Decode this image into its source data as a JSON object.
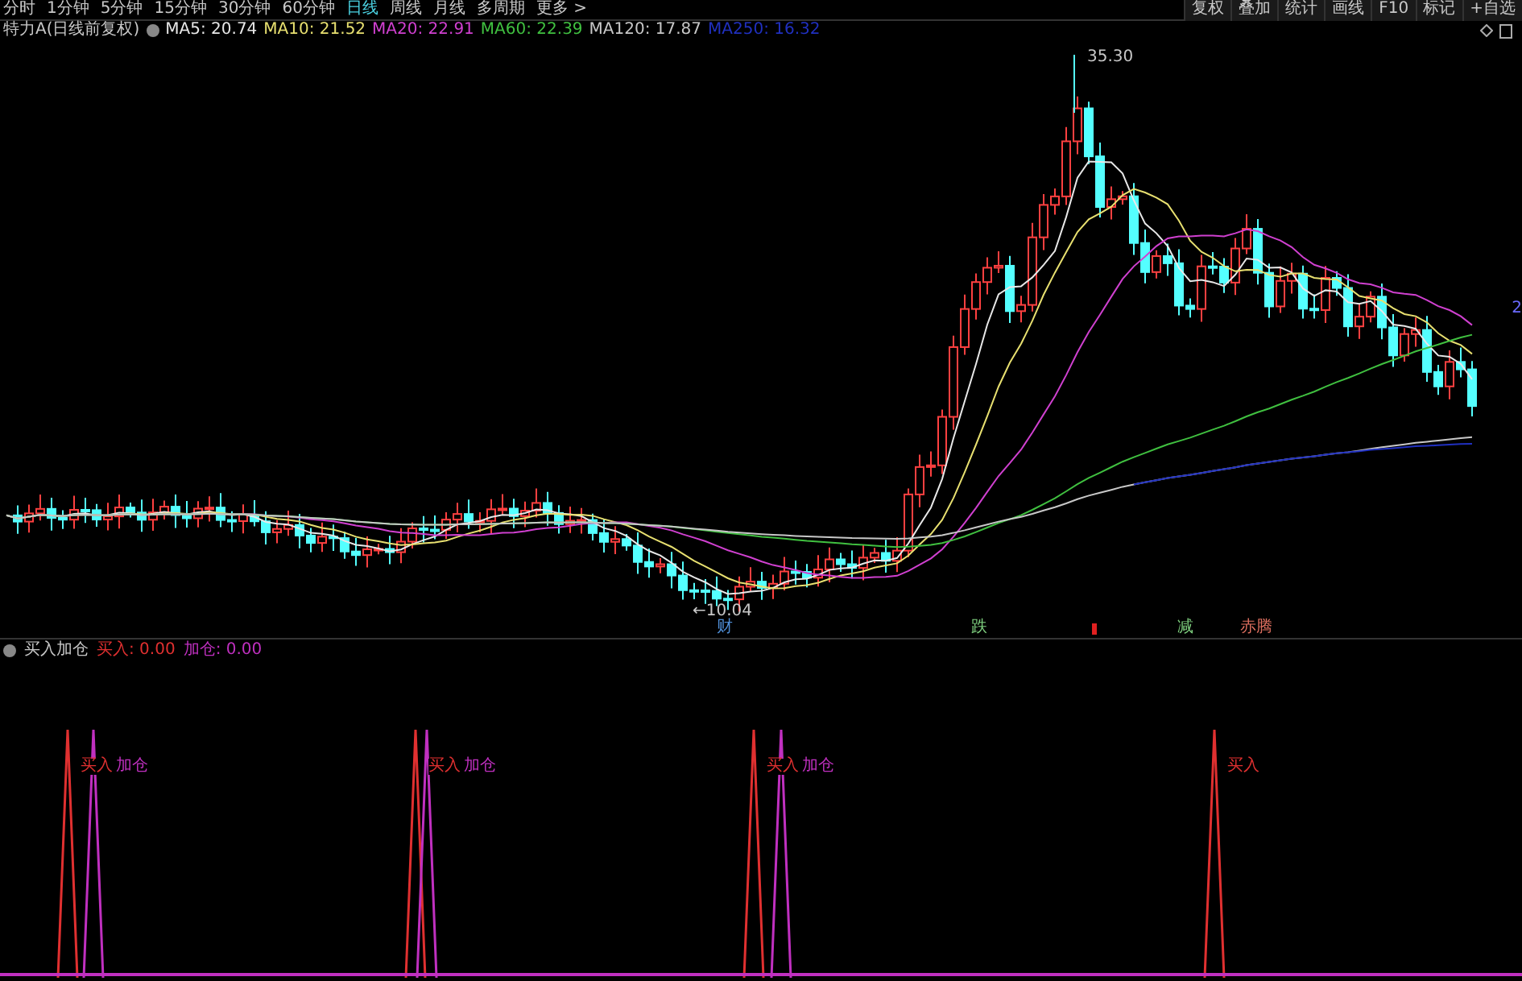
{
  "toolbar": {
    "periods": [
      {
        "label": "分时",
        "selected": false
      },
      {
        "label": "1分钟",
        "selected": false
      },
      {
        "label": "5分钟",
        "selected": false
      },
      {
        "label": "15分钟",
        "selected": false
      },
      {
        "label": "30分钟",
        "selected": false
      },
      {
        "label": "60分钟",
        "selected": false
      },
      {
        "label": "日线",
        "selected": true
      },
      {
        "label": "周线",
        "selected": false
      },
      {
        "label": "月线",
        "selected": false
      },
      {
        "label": "多周期",
        "selected": false
      },
      {
        "label": "更多 >",
        "selected": false
      }
    ],
    "tools": [
      "复权",
      "叠加",
      "统计",
      "画线",
      "F10",
      "标记",
      "+自选"
    ]
  },
  "legend": {
    "title": "特力A(日线前复权)",
    "items": [
      {
        "label": "MA5: 20.74",
        "color": "#e8e8e8"
      },
      {
        "label": "MA10: 21.52",
        "color": "#e8e070"
      },
      {
        "label": "MA20: 22.91",
        "color": "#d040d0"
      },
      {
        "label": "MA60: 22.39",
        "color": "#40c040"
      },
      {
        "label": "MA120: 17.87",
        "color": "#c8c8c8"
      },
      {
        "label": "MA250: 16.32",
        "color": "#2030c0"
      }
    ]
  },
  "price_labels": {
    "high": "35.30",
    "low": "←10.04"
  },
  "right_axis_label": "2",
  "markers": [
    {
      "text": "财",
      "color": "#4f8fd8"
    },
    {
      "text": "跌",
      "color": "#7fd07f"
    },
    {
      "text": "减",
      "color": "#7fd07f"
    },
    {
      "text": "赤腾",
      "color": "#e07060"
    }
  ],
  "indicator": {
    "title": "买入加仓",
    "values": [
      {
        "label": "买入: 0.00",
        "color": "#e03030"
      },
      {
        "label": "加仓: 0.00",
        "color": "#c030c0"
      }
    ],
    "signals": [
      {
        "buy": "买入",
        "add": "加仓"
      },
      {
        "buy": "买入",
        "add": "加仓"
      },
      {
        "buy": "买入",
        "add": "加仓"
      },
      {
        "buy": "买入"
      }
    ]
  }
}
